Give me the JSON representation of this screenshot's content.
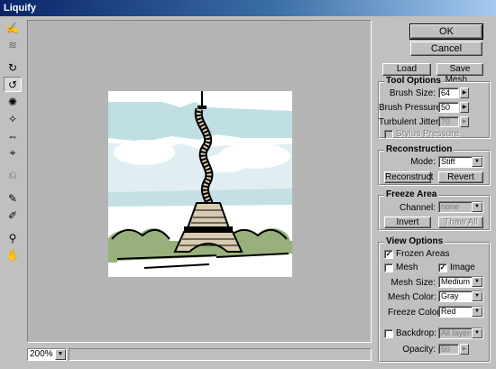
{
  "window": {
    "title": "Liquify"
  },
  "toolbar": {
    "tools": [
      {
        "name": "warp-tool-icon",
        "glyph": "✍"
      },
      {
        "name": "turbulence-tool-icon",
        "glyph": "≋"
      },
      {
        "name": "twirl-clockwise-tool-icon",
        "glyph": "↻"
      },
      {
        "name": "twirl-counterclockwise-tool-icon",
        "glyph": "↺"
      },
      {
        "name": "pucker-tool-icon",
        "glyph": "✺"
      },
      {
        "name": "bloat-tool-icon",
        "glyph": "✧"
      },
      {
        "name": "shift-pixels-tool-icon",
        "glyph": "⇔"
      },
      {
        "name": "reflection-tool-icon",
        "glyph": "⌖"
      },
      {
        "name": "reconstruct-tool-icon",
        "glyph": "⎌"
      },
      {
        "name": "freeze-tool-icon",
        "glyph": "✎"
      },
      {
        "name": "thaw-tool-icon",
        "glyph": "✐"
      },
      {
        "name": "zoom-tool-icon",
        "glyph": "⚲"
      },
      {
        "name": "hand-tool-icon",
        "glyph": "✋"
      }
    ]
  },
  "preview": {
    "zoom": "200%"
  },
  "buttons": {
    "ok": "OK",
    "cancel": "Cancel",
    "load_mesh": "Load Mesh...",
    "save_mesh": "Save Mesh..."
  },
  "tool_options": {
    "title": "Tool Options",
    "brush_size": {
      "label": "Brush Size:",
      "value": "64"
    },
    "brush_pressure": {
      "label": "Brush Pressure:",
      "value": "50"
    },
    "turbulent_jitter": {
      "label": "Turbulent Jitter:",
      "value": "70"
    },
    "stylus_pressure": {
      "label": "Stylus Pressure",
      "checked": false
    }
  },
  "reconstruction": {
    "title": "Reconstruction",
    "mode_label": "Mode:",
    "mode_value": "Stiff",
    "reconstruct": "Reconstruct",
    "revert": "Revert"
  },
  "freeze_area": {
    "title": "Freeze Area",
    "channel_label": "Channel:",
    "channel_value": "none",
    "invert": "Invert",
    "thaw_all": "Thaw All"
  },
  "view_options": {
    "title": "View Options",
    "frozen_areas": {
      "label": "Frozen Areas",
      "checked": true
    },
    "mesh": {
      "label": "Mesh",
      "checked": false
    },
    "image": {
      "label": "Image",
      "checked": true
    },
    "mesh_size": {
      "label": "Mesh Size:",
      "value": "Medium"
    },
    "mesh_color": {
      "label": "Mesh Color:",
      "value": "Gray"
    },
    "freeze_color": {
      "label": "Freeze Color:",
      "value": "Red"
    },
    "backdrop": {
      "label": "Backdrop:",
      "checked": false,
      "value": "All layers"
    },
    "opacity": {
      "label": "Opacity:",
      "value": "50"
    }
  }
}
